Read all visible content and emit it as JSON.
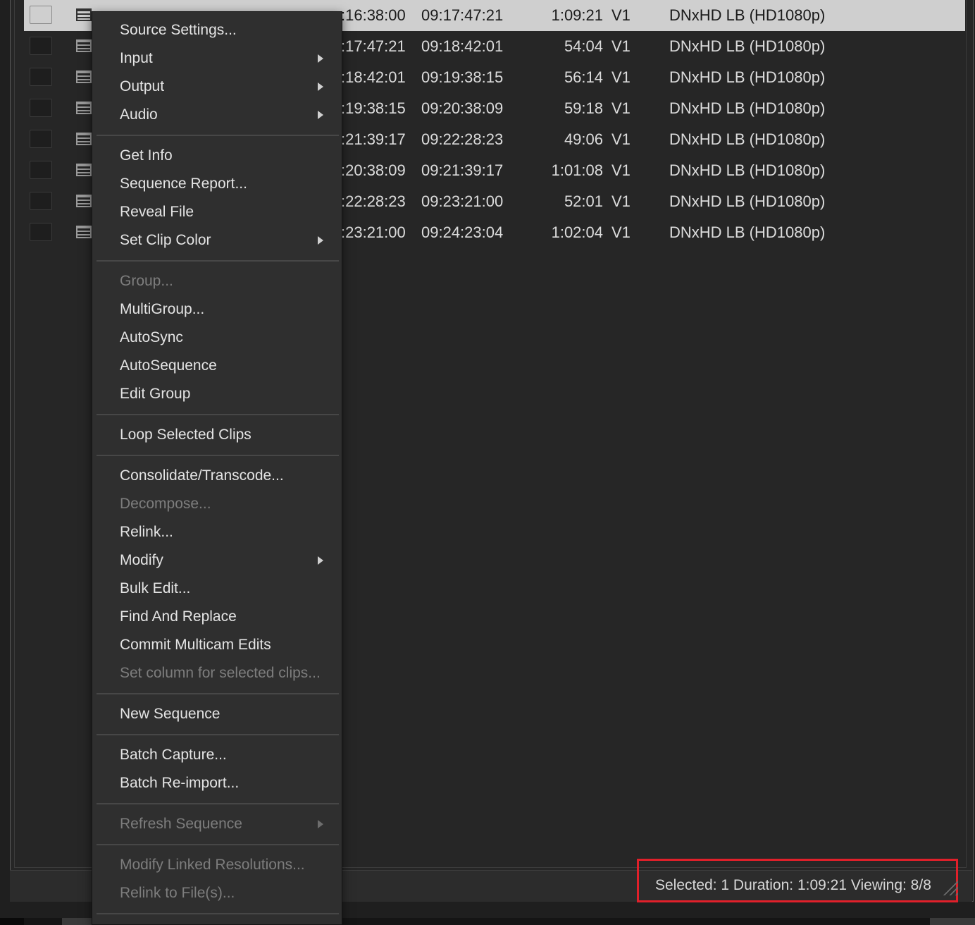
{
  "rows": [
    {
      "start": ":16:38:00",
      "end": "09:17:47:21",
      "duration": "1:09:21",
      "track": "V1",
      "format": "DNxHD LB (HD1080p)",
      "selected": true
    },
    {
      "start": ":17:47:21",
      "end": "09:18:42:01",
      "duration": "54:04",
      "track": "V1",
      "format": "DNxHD LB (HD1080p)"
    },
    {
      "start": ":18:42:01",
      "end": "09:19:38:15",
      "duration": "56:14",
      "track": "V1",
      "format": "DNxHD LB (HD1080p)"
    },
    {
      "start": ":19:38:15",
      "end": "09:20:38:09",
      "duration": "59:18",
      "track": "V1",
      "format": "DNxHD LB (HD1080p)"
    },
    {
      "start": ":21:39:17",
      "end": "09:22:28:23",
      "duration": "49:06",
      "track": "V1",
      "format": "DNxHD LB (HD1080p)"
    },
    {
      "start": ":20:38:09",
      "end": "09:21:39:17",
      "duration": "1:01:08",
      "track": "V1",
      "format": "DNxHD LB (HD1080p)"
    },
    {
      "start": ":22:28:23",
      "end": "09:23:21:00",
      "duration": "52:01",
      "track": "V1",
      "format": "DNxHD LB (HD1080p)"
    },
    {
      "start": ":23:21:00",
      "end": "09:24:23:04",
      "duration": "1:02:04",
      "track": "V1",
      "format": "DNxHD LB (HD1080p)"
    }
  ],
  "menu": {
    "items": [
      {
        "label": "Source Settings...",
        "name": "menu-source-settings"
      },
      {
        "label": "Input",
        "name": "menu-input",
        "submenu": true
      },
      {
        "label": "Output",
        "name": "menu-output",
        "submenu": true
      },
      {
        "label": "Audio",
        "name": "menu-audio",
        "submenu": true
      },
      {
        "separator": true
      },
      {
        "label": "Get Info",
        "name": "menu-get-info"
      },
      {
        "label": "Sequence Report...",
        "name": "menu-sequence-report"
      },
      {
        "label": "Reveal File",
        "name": "menu-reveal-file"
      },
      {
        "label": "Set Clip Color",
        "name": "menu-set-clip-color",
        "submenu": true
      },
      {
        "separator": true
      },
      {
        "label": "Group...",
        "name": "menu-group",
        "disabled": true
      },
      {
        "label": "MultiGroup...",
        "name": "menu-multigroup"
      },
      {
        "label": "AutoSync",
        "name": "menu-autosync"
      },
      {
        "label": "AutoSequence",
        "name": "menu-autosequence"
      },
      {
        "label": "Edit Group",
        "name": "menu-edit-group"
      },
      {
        "separator": true
      },
      {
        "label": "Loop Selected Clips",
        "name": "menu-loop-selected-clips"
      },
      {
        "separator": true
      },
      {
        "label": "Consolidate/Transcode...",
        "name": "menu-consolidate-transcode"
      },
      {
        "label": "Decompose...",
        "name": "menu-decompose",
        "disabled": true
      },
      {
        "label": "Relink...",
        "name": "menu-relink"
      },
      {
        "label": "Modify",
        "name": "menu-modify",
        "submenu": true
      },
      {
        "label": "Bulk Edit...",
        "name": "menu-bulk-edit"
      },
      {
        "label": "Find And Replace",
        "name": "menu-find-and-replace"
      },
      {
        "label": "Commit Multicam Edits",
        "name": "menu-commit-multicam-edits"
      },
      {
        "label": "Set column for selected clips...",
        "name": "menu-set-column",
        "disabled": true
      },
      {
        "separator": true
      },
      {
        "label": "New Sequence",
        "name": "menu-new-sequence"
      },
      {
        "separator": true
      },
      {
        "label": "Batch Capture...",
        "name": "menu-batch-capture"
      },
      {
        "label": "Batch Re-import...",
        "name": "menu-batch-reimport"
      },
      {
        "separator": true
      },
      {
        "label": "Refresh Sequence",
        "name": "menu-refresh-sequence",
        "submenu": true,
        "disabled": true
      },
      {
        "separator": true
      },
      {
        "label": "Modify Linked Resolutions...",
        "name": "menu-modify-linked-resolutions",
        "disabled": true
      },
      {
        "label": "Relink to File(s)...",
        "name": "menu-relink-to-files",
        "disabled": true
      },
      {
        "separator": true
      }
    ]
  },
  "status": {
    "text": "Selected: 1 Duration: 1:09:21   Viewing: 8/8"
  },
  "colors": {
    "highlight_box": "#e0202a",
    "selected_row": "#cfcfcf"
  }
}
